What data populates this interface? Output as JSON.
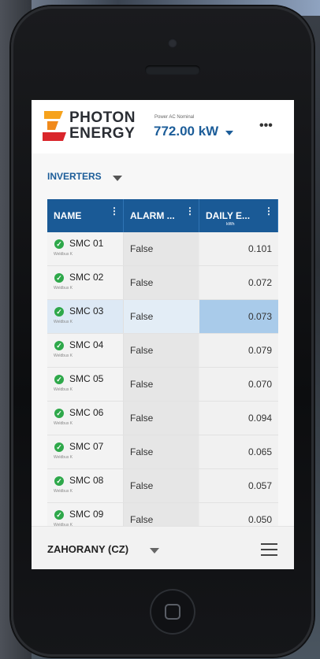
{
  "header": {
    "logo_line1": "PHOTON",
    "logo_line2": "ENERGY",
    "power_label": "Power AC Nominal",
    "power_value": "772.00 kW",
    "more_icon": "more-dots-icon"
  },
  "section": {
    "title": "INVERTERS"
  },
  "table": {
    "columns": [
      "NAME",
      "ALARM ...",
      "DAILY E..."
    ],
    "col3_unit": "kWh",
    "rows": [
      {
        "name": "SMC 01",
        "sub": "Weldbus K",
        "alarm": "False",
        "value": "0.101"
      },
      {
        "name": "SMC 02",
        "sub": "Weldbus K",
        "alarm": "False",
        "value": "0.072"
      },
      {
        "name": "SMC 03",
        "sub": "Weldbus K",
        "alarm": "False",
        "value": "0.073"
      },
      {
        "name": "SMC 04",
        "sub": "Weldbus K",
        "alarm": "False",
        "value": "0.079"
      },
      {
        "name": "SMC 05",
        "sub": "Weldbus K",
        "alarm": "False",
        "value": "0.070"
      },
      {
        "name": "SMC 06",
        "sub": "Weldbus K",
        "alarm": "False",
        "value": "0.094"
      },
      {
        "name": "SMC 07",
        "sub": "Weldbus K",
        "alarm": "False",
        "value": "0.065"
      },
      {
        "name": "SMC 08",
        "sub": "Weldbus K",
        "alarm": "False",
        "value": "0.057"
      },
      {
        "name": "SMC 09",
        "sub": "Weldbus K",
        "alarm": "False",
        "value": "0.050"
      }
    ]
  },
  "footer": {
    "site": "ZAHORANY (CZ)"
  },
  "colors": {
    "brand_blue": "#1c5d99",
    "status_ok": "#2ea84a",
    "logo_orange": "#f08a1c",
    "logo_red": "#d9262b"
  }
}
